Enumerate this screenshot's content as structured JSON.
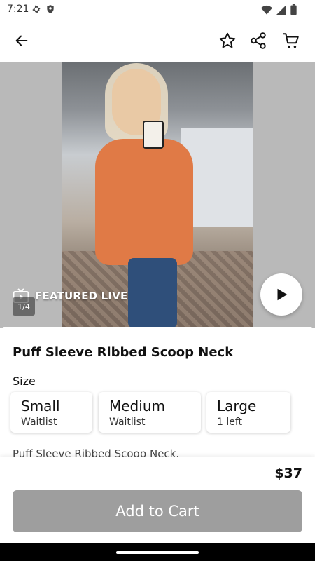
{
  "status_bar": {
    "time": "7:21",
    "icons_left": [
      "gear-icon",
      "shield-icon"
    ],
    "icons_right": [
      "wifi-icon",
      "signal-icon",
      "battery-icon"
    ]
  },
  "app_bar": {
    "icons": [
      "back-arrow-icon",
      "star-icon",
      "share-icon",
      "cart-icon"
    ]
  },
  "media": {
    "featured_label": "FEATURED LIVE",
    "counter": "1/4"
  },
  "product": {
    "title": "Puff Sleeve Ribbed Scoop Neck",
    "size_label": "Size",
    "sizes": [
      {
        "name": "Small",
        "status": "Waitlist"
      },
      {
        "name": "Medium",
        "status": "Waitlist"
      },
      {
        "name": "Large",
        "status": "1 left"
      }
    ],
    "description": "Puff Sleeve Ribbed Scoop Neck.",
    "price": "$37",
    "add_to_cart": "Add to Cart"
  },
  "colors": {
    "button_disabled": "#9e9e9e",
    "sweater": "#e07a46"
  }
}
